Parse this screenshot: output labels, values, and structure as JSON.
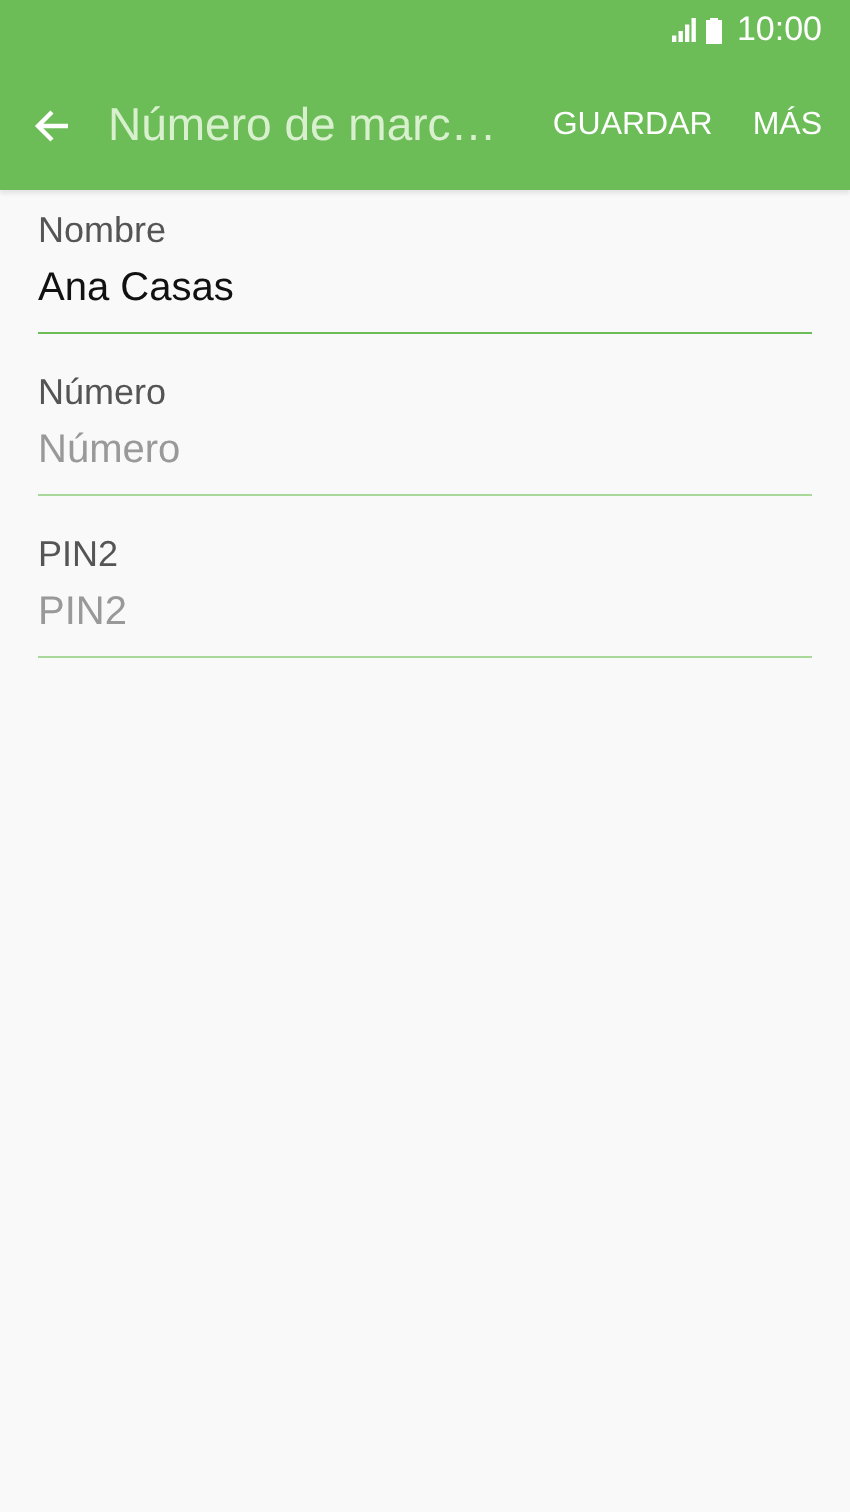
{
  "status_bar": {
    "time": "10:00"
  },
  "toolbar": {
    "title": "Número de marc…",
    "actions": [
      "GUARDAR",
      "MÁS"
    ]
  },
  "fields": [
    {
      "label": "Nombre",
      "value": "Ana Casas",
      "focused": true
    },
    {
      "label": "Número",
      "placeholder": "Número",
      "focused": false
    },
    {
      "label": "PIN2",
      "placeholder": "PIN2",
      "focused": false
    }
  ]
}
